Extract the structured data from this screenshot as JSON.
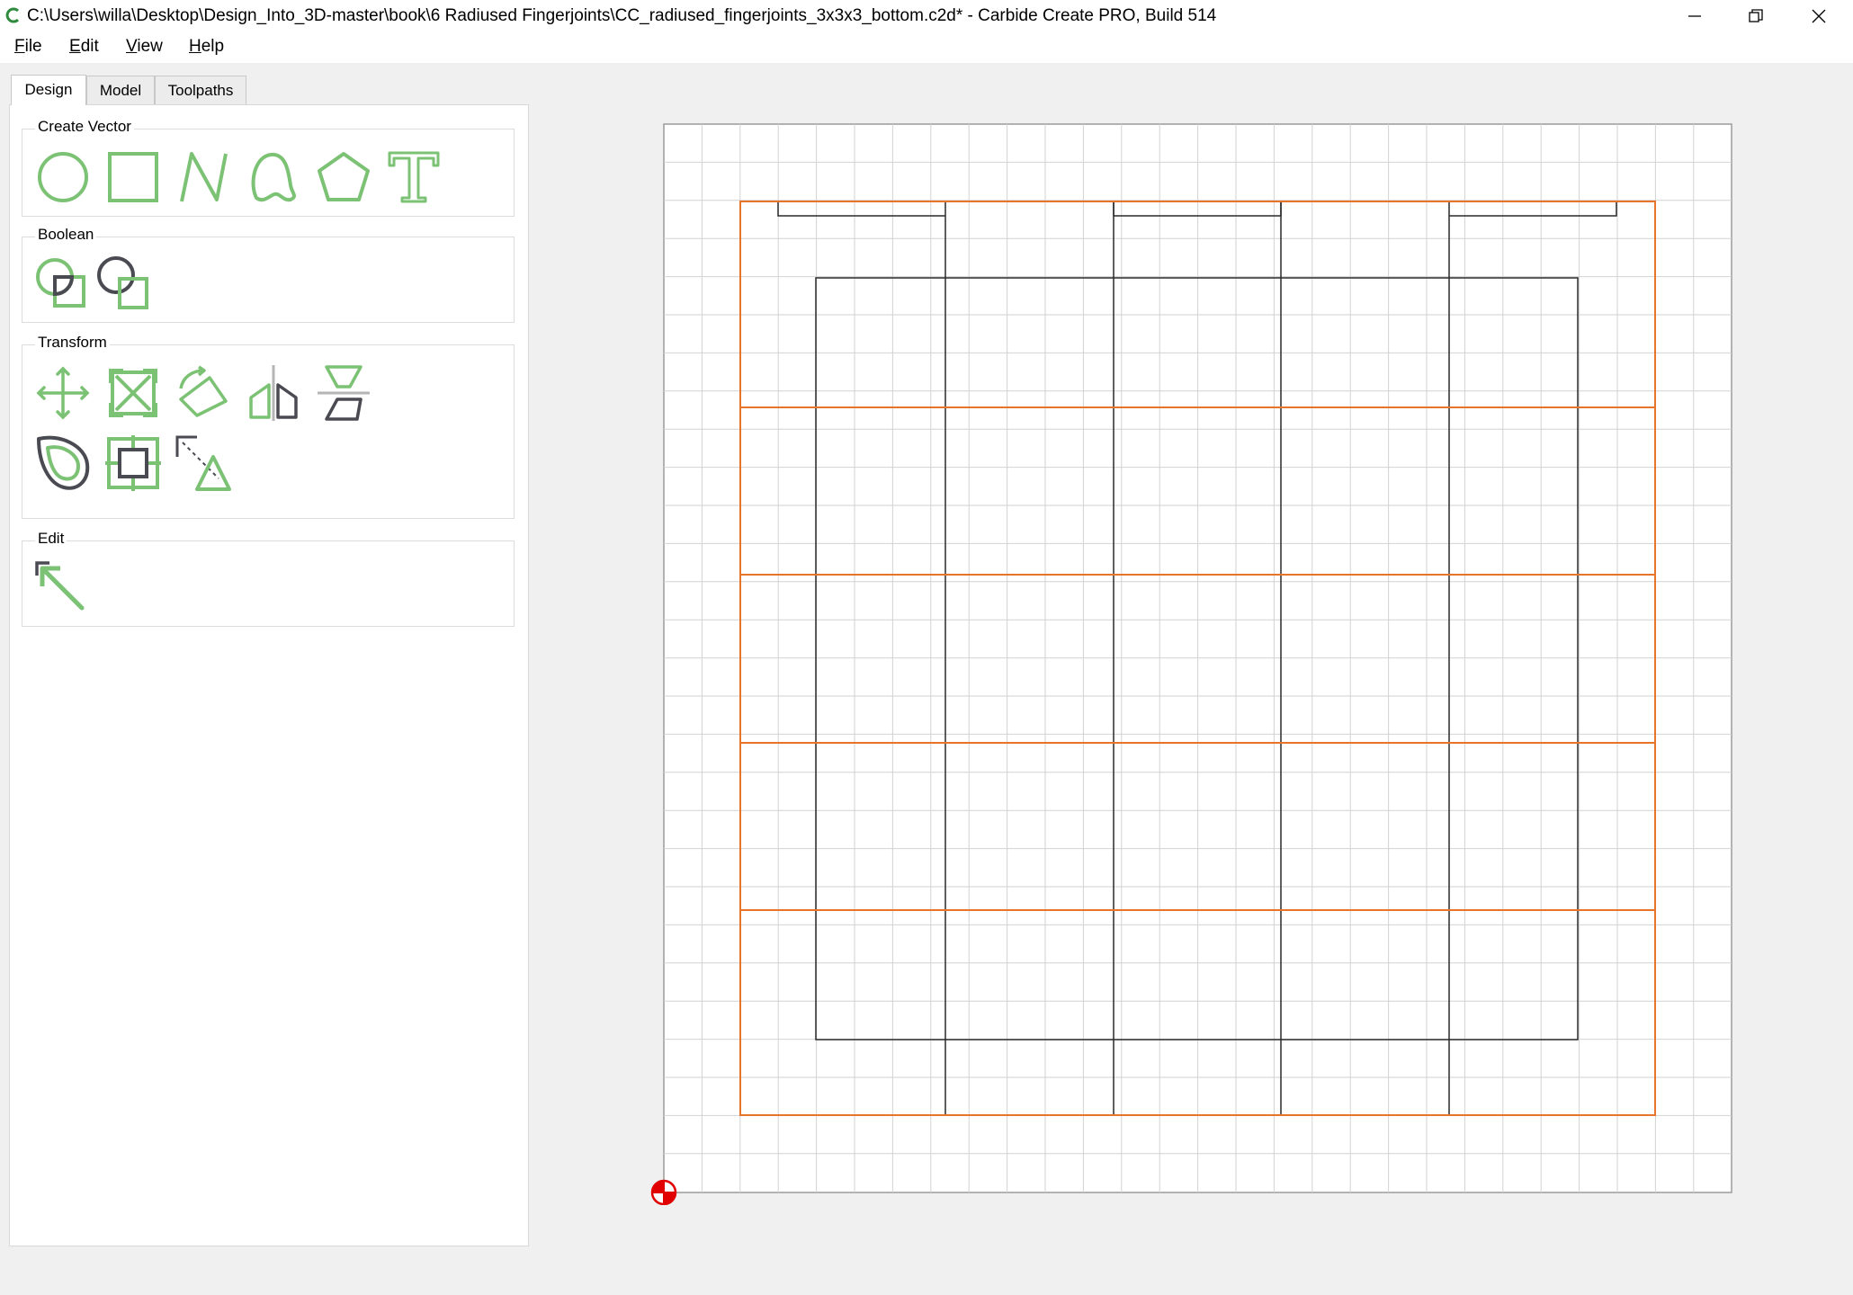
{
  "window": {
    "title": "C:\\Users\\willa\\Desktop\\Design_Into_3D-master\\book\\6 Radiused Fingerjoints\\CC_radiused_fingerjoints_3x3x3_bottom.c2d* - Carbide Create PRO, Build 514",
    "minimize_icon": "minimize-icon",
    "restore_icon": "restore-icon",
    "close_icon": "close-icon"
  },
  "menu": {
    "items": [
      "File",
      "Edit",
      "View",
      "Help"
    ]
  },
  "tabs": [
    "Design",
    "Model",
    "Toolpaths"
  ],
  "active_tab": "Design",
  "groups": {
    "create_vector": {
      "label": "Create Vector",
      "tools": [
        "circle-icon",
        "rectangle-icon",
        "polyline-icon",
        "curve-icon",
        "polygon-icon",
        "text-icon"
      ]
    },
    "boolean": {
      "label": "Boolean",
      "tools": [
        "boolean-union-icon",
        "boolean-subtract-icon"
      ]
    },
    "transform": {
      "label": "Transform",
      "tools": [
        "move-icon",
        "scale-icon",
        "rotate-icon",
        "mirror-icon",
        "align-icon",
        "offset-icon",
        "array-icon",
        "distort-icon"
      ]
    },
    "edit": {
      "label": "Edit",
      "tools": [
        "node-edit-icon"
      ]
    }
  },
  "colors": {
    "accent_green": "#7cc274",
    "dark_icon": "#4a4a52",
    "stock_orange": "#e8742a",
    "vector_black": "#2a2a2a",
    "grid_line": "#cfcfcf",
    "origin_red": "#e00000"
  }
}
